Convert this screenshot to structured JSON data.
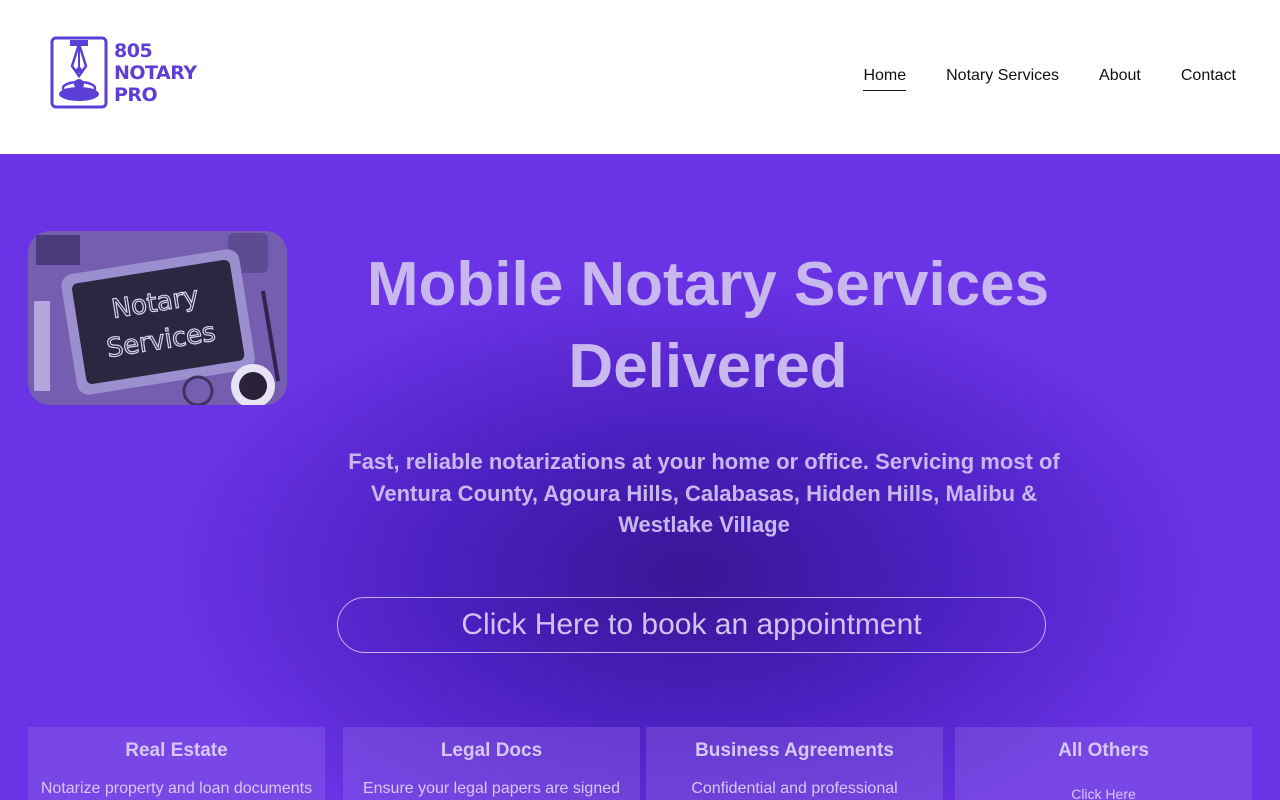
{
  "brand": {
    "line1": "805",
    "line2": "NOTARY",
    "line3": "PRO",
    "color": "#5b3fd6"
  },
  "nav": {
    "items": [
      {
        "label": "Home",
        "active": true
      },
      {
        "label": "Notary Services",
        "active": false
      },
      {
        "label": "About",
        "active": false
      },
      {
        "label": "Contact",
        "active": false
      }
    ]
  },
  "hero": {
    "image_text": {
      "line1": "Notary",
      "line2": "Services"
    },
    "title_line1": "Mobile Notary Services",
    "title_line2": "Delivered",
    "subtitle": "Fast, reliable notarizations at your home or office. Servicing most of Ventura County, Agoura Hills, Calabasas, Hidden Hills, Malibu & Westlake Village",
    "cta_label": "Click Here to book an appointment"
  },
  "cards": [
    {
      "title": "Real Estate",
      "text": "Notarize property and loan documents"
    },
    {
      "title": "Legal Docs",
      "text": "Ensure your legal papers are signed"
    },
    {
      "title": "Business Agreements",
      "text": "Confidential and professional"
    },
    {
      "title": "All Others",
      "text": "Click Here"
    }
  ],
  "colors": {
    "accent": "#5b3fd6",
    "hero_bg": "#6a33e6",
    "hero_text": "#c9b7ef"
  }
}
